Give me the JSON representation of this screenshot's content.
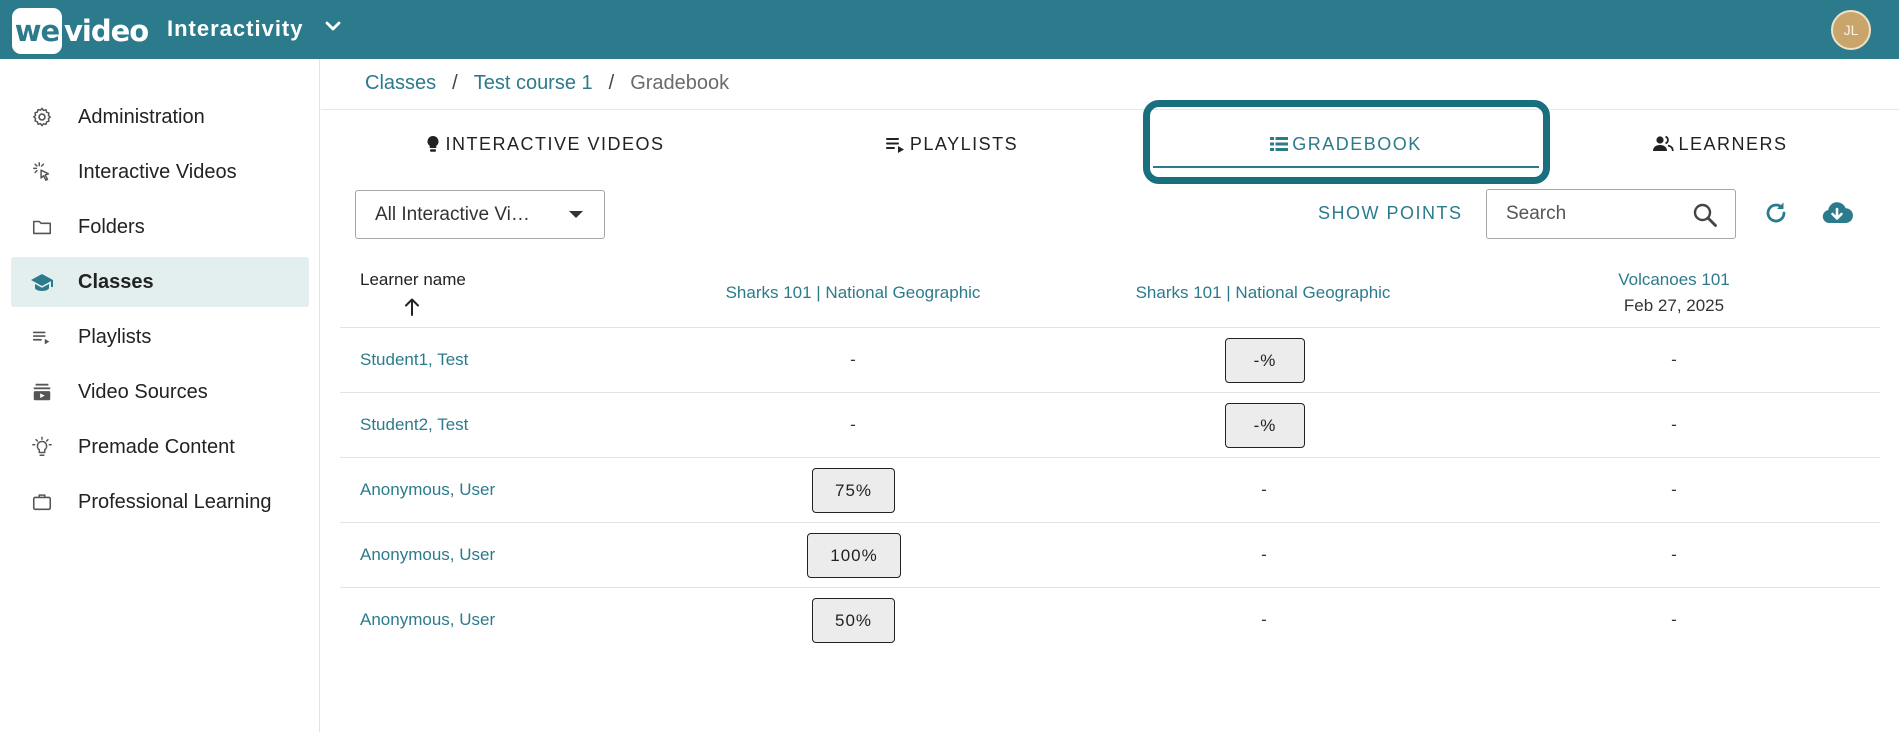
{
  "app": {
    "logo_we": "we",
    "logo_video": "video",
    "title": "Interactivity",
    "avatar_initials": "JL",
    "colors": {
      "brand": "#2c7b8c",
      "highlight": "#1a6f7f",
      "avatar": "#c9a56b"
    }
  },
  "sidebar": {
    "items": [
      {
        "label": "Administration",
        "icon": "gear-icon"
      },
      {
        "label": "Interactive Videos",
        "icon": "pointer-click-icon"
      },
      {
        "label": "Folders",
        "icon": "folder-icon"
      },
      {
        "label": "Classes",
        "icon": "graduation-cap-icon",
        "active": true
      },
      {
        "label": "Playlists",
        "icon": "playlist-icon"
      },
      {
        "label": "Video Sources",
        "icon": "video-stack-icon"
      },
      {
        "label": "Premade Content",
        "icon": "lightbulb-icon"
      },
      {
        "label": "Professional Learning",
        "icon": "briefcase-icon"
      }
    ]
  },
  "breadcrumb": {
    "items": [
      "Classes",
      "Test course 1",
      "Gradebook"
    ],
    "separator": "/"
  },
  "tabs": [
    {
      "label": "INTERACTIVE VIDEOS",
      "icon": "lightbulb-icon"
    },
    {
      "label": "PLAYLISTS",
      "icon": "playlist-icon"
    },
    {
      "label": "GRADEBOOK",
      "icon": "list-icon",
      "active": true
    },
    {
      "label": "LEARNERS",
      "icon": "users-icon"
    }
  ],
  "toolbar": {
    "filter_value": "All Interactive Vi…",
    "show_points_label": "SHOW POINTS",
    "search_placeholder": "Search"
  },
  "table": {
    "learner_header": "Learner name",
    "columns": [
      {
        "title": "Sharks 101 | National Geographic",
        "date": ""
      },
      {
        "title": "Sharks 101 | National Geographic",
        "date": ""
      },
      {
        "title": "Volcanoes 101",
        "date": "Feb 27, 2025"
      }
    ],
    "rows": [
      {
        "name": "Student1, Test",
        "cells": [
          "-",
          "-%",
          "-"
        ]
      },
      {
        "name": "Student2, Test",
        "cells": [
          "-",
          "-%",
          "-"
        ]
      },
      {
        "name": "Anonymous, User",
        "cells": [
          "75%",
          "-",
          "-"
        ]
      },
      {
        "name": "Anonymous, User",
        "cells": [
          "100%",
          "-",
          "-"
        ]
      },
      {
        "name": "Anonymous, User",
        "cells": [
          "50%",
          "-",
          "-"
        ]
      }
    ]
  }
}
